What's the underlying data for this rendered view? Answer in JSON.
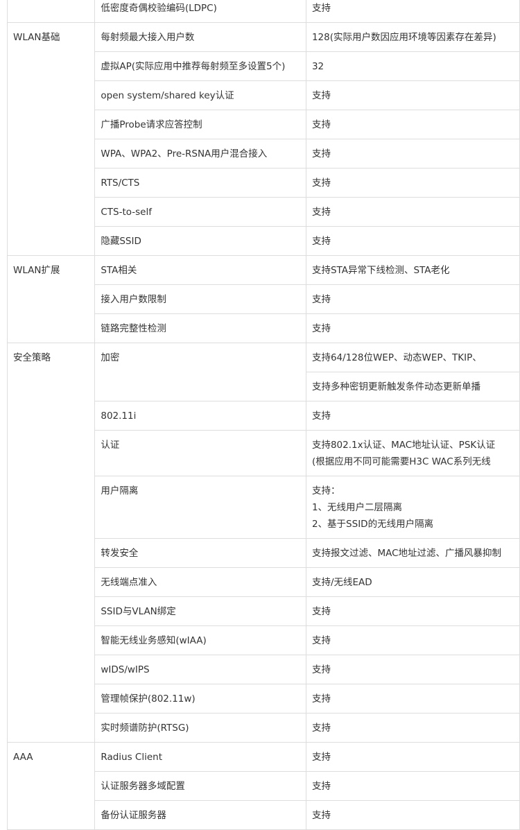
{
  "groups": [
    {
      "category": "",
      "rows": [
        {
          "feature": "低密度奇偶校验编码(LDPC)",
          "value": [
            "支持"
          ]
        }
      ]
    },
    {
      "category": "WLAN基础",
      "rows": [
        {
          "feature": "每射频最大接入用户数",
          "value": [
            "128(实际用户数因应用环境等因素存在差异)"
          ]
        },
        {
          "feature": "虚拟AP(实际应用中推荐每射频至多设置5个)",
          "value": [
            "32"
          ]
        },
        {
          "feature": "open system/shared key认证",
          "value": [
            "支持"
          ]
        },
        {
          "feature": "广播Probe请求应答控制",
          "value": [
            "支持"
          ]
        },
        {
          "feature": "WPA、WPA2、Pre-RSNA用户混合接入",
          "value": [
            "支持"
          ]
        },
        {
          "feature": "RTS/CTS",
          "value": [
            "支持"
          ]
        },
        {
          "feature": "CTS-to-self",
          "value": [
            "支持"
          ]
        },
        {
          "feature": "隐藏SSID",
          "value": [
            "支持"
          ]
        }
      ]
    },
    {
      "category": "WLAN扩展",
      "rows": [
        {
          "feature": "STA相关",
          "value": [
            "支持STA异常下线检测、STA老化"
          ]
        },
        {
          "feature": "接入用户数限制",
          "value": [
            "支持"
          ]
        },
        {
          "feature": "链路完整性检测",
          "value": [
            "支持"
          ]
        }
      ]
    },
    {
      "category": "安全策略",
      "rows": [
        {
          "feature": "加密",
          "value": [
            "支持64/128位WEP、动态WEP、TKIP、"
          ],
          "extra_value": [
            "支持多种密钥更新触发条件动态更新单播"
          ]
        },
        {
          "feature": "802.11i",
          "value": [
            "支持"
          ]
        },
        {
          "feature": "认证",
          "value": [
            "支持802.1x认证、MAC地址认证、PSK认证",
            "(根据应用不同可能需要H3C WAC系列无线"
          ]
        },
        {
          "feature": "用户隔离",
          "value": [
            "支持：",
            "1、无线用户二层隔离",
            "2、基于SSID的无线用户隔离"
          ]
        },
        {
          "feature": "转发安全",
          "value": [
            "支持报文过滤、MAC地址过滤、广播风暴抑制"
          ]
        },
        {
          "feature": "无线端点准入",
          "value": [
            "支持/无线EAD"
          ]
        },
        {
          "feature": "SSID与VLAN绑定",
          "value": [
            "支持"
          ]
        },
        {
          "feature": "智能无线业务感知(wIAA)",
          "value": [
            "支持"
          ]
        },
        {
          "feature": "wIDS/wIPS",
          "value": [
            "支持"
          ]
        },
        {
          "feature": "管理帧保护(802.11w)",
          "value": [
            "支持"
          ]
        },
        {
          "feature": "实时频谱防护(RTSG)",
          "value": [
            "支持"
          ]
        }
      ]
    },
    {
      "category": "AAA",
      "rows": [
        {
          "feature": "Radius Client",
          "value": [
            "支持"
          ]
        },
        {
          "feature": "认证服务器多域配置",
          "value": [
            "支持"
          ]
        },
        {
          "feature": "备份认证服务器",
          "value": [
            "支持"
          ]
        }
      ]
    }
  ],
  "colors": {
    "border": "#dddddd",
    "text": "#333333",
    "background": "#ffffff"
  }
}
